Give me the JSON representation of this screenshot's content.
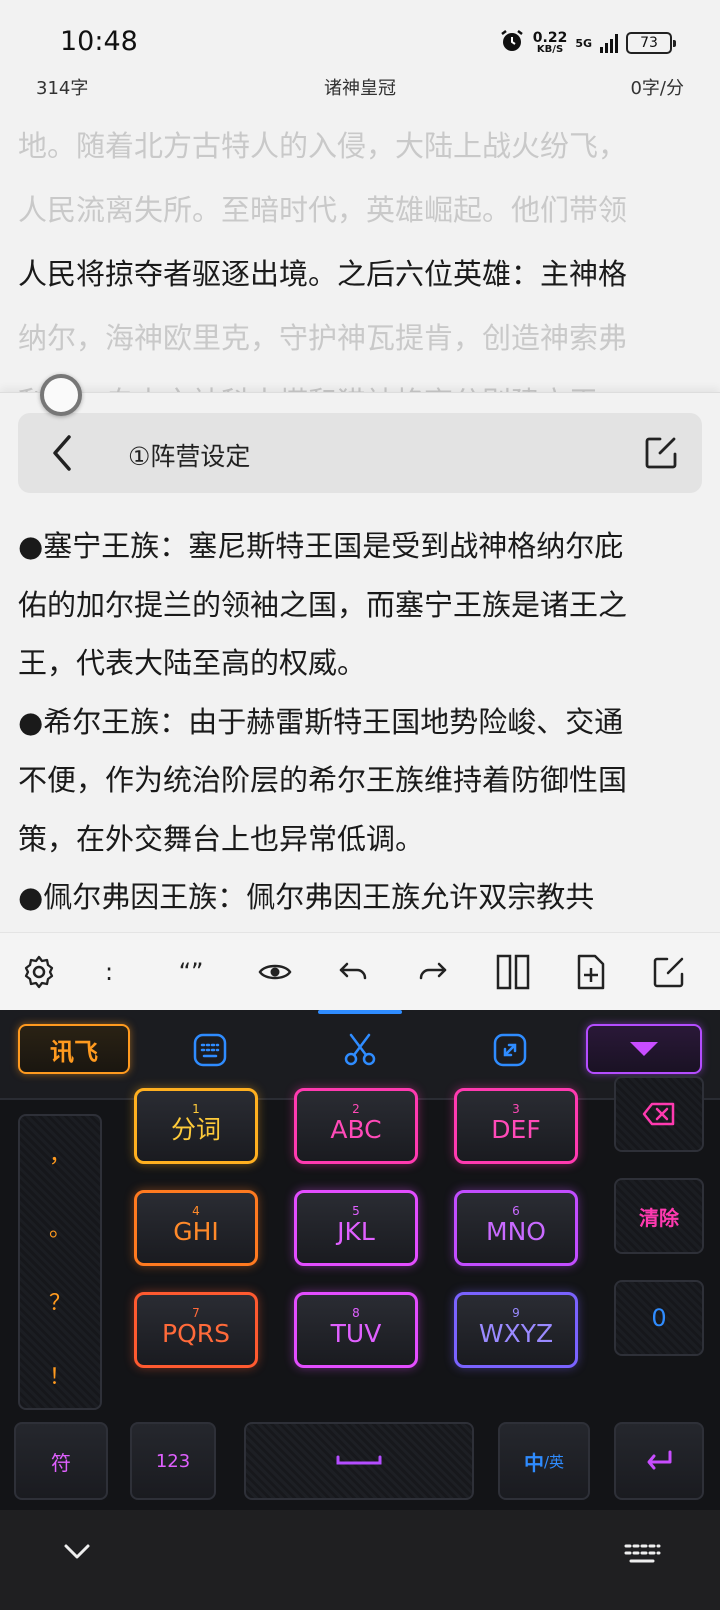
{
  "status": {
    "time": "10:48",
    "speed_value": "0.22",
    "speed_unit": "KB/S",
    "network": "5G",
    "battery": "73"
  },
  "reader": {
    "word_count": "314字",
    "book_title": "诸神皇冠",
    "speed": "0字/分"
  },
  "background_text": [
    "地。随着北方古特人的入侵，大陆上战火纷飞，",
    "人民流离失所。至暗时代，英雄崛起。他们带领",
    "人民将掠夺者驱逐出境。之后六位英雄：主神格",
    "纳尔，海神欧里克，守护神瓦提肯，创造神索弗",
    "利克，自由之神科中塔和猎神格齐分别建立王"
  ],
  "panel": {
    "title": "①阵营设定",
    "lines": [
      "●塞宁王族：塞尼斯特王国是受到战神格纳尔庇",
      "佑的加尔提兰的领袖之国，而塞宁王族是诸王之",
      "王，代表大陆至高的权威。",
      "●希尔王族：由于赫雷斯特王国地势险峻、交通",
      "不便，作为统治阶层的希尔王族维持着防御性国",
      "策，在外交舞台上也异常低调。",
      "●佩尔弗因王族：佩尔弗因王族允许双宗教共"
    ]
  },
  "toolbar": {
    "colon": ":",
    "quotes": "“”"
  },
  "keyboard": {
    "logo": "讯飞",
    "punctuation": [
      "，",
      "。",
      "？",
      "！"
    ],
    "keys": [
      {
        "num": "1",
        "label": "分词"
      },
      {
        "num": "2",
        "label": "ABC"
      },
      {
        "num": "3",
        "label": "DEF"
      },
      {
        "num": "4",
        "label": "GHI"
      },
      {
        "num": "5",
        "label": "JKL"
      },
      {
        "num": "6",
        "label": "MNO"
      },
      {
        "num": "7",
        "label": "PQRS"
      },
      {
        "num": "8",
        "label": "TUV"
      },
      {
        "num": "9",
        "label": "WXYZ"
      }
    ],
    "clear": "清除",
    "zero": "0",
    "symbol": "符",
    "numbers": "123",
    "lang_main": "中",
    "lang_sep": "/英"
  },
  "colors": {
    "orange": "#ffb020",
    "pink": "#ff3ab0",
    "purple": "#c24dff",
    "blue": "#2f8cff"
  }
}
